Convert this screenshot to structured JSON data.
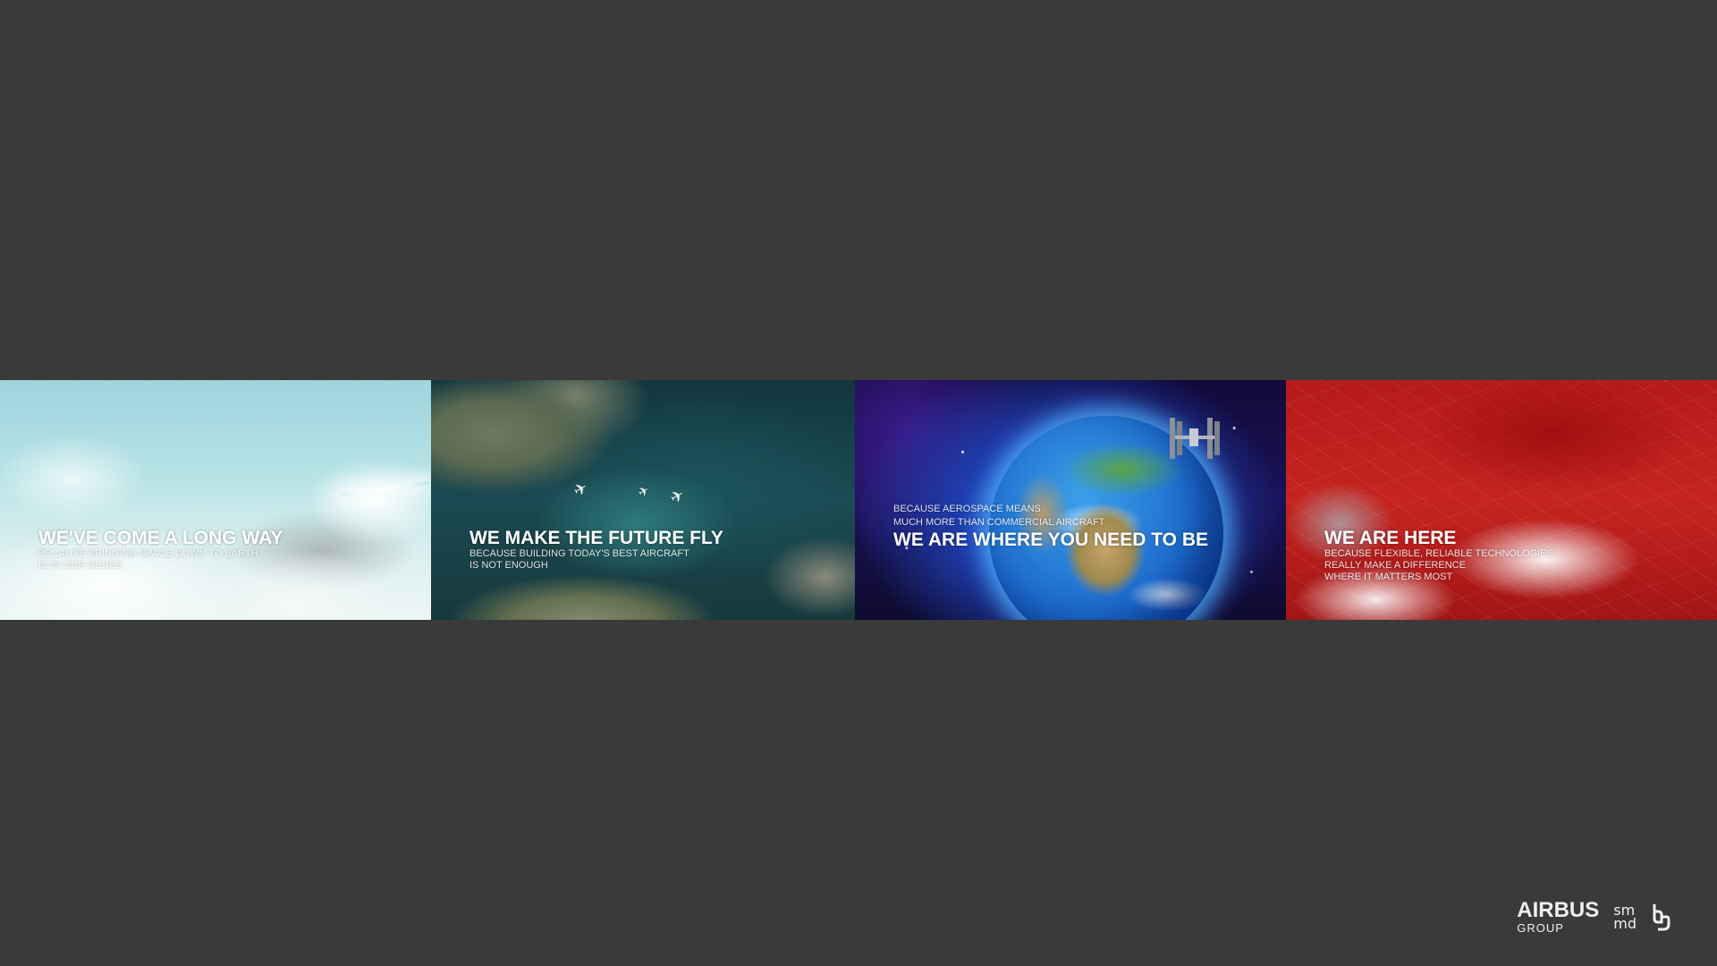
{
  "panels": [
    {
      "title": "WE'VE COME A LONG WAY",
      "subtitle_lines": [
        "BECAUSE BRINGING SPACE DOWN TO EARTH",
        "IS IN OUR GENES"
      ]
    },
    {
      "title": "WE MAKE THE FUTURE FLY",
      "subtitle_lines": [
        "BECAUSE BUILDING TODAY'S BEST AIRCRAFT",
        "IS NOT ENOUGH"
      ]
    },
    {
      "title": "WE ARE WHERE YOU NEED TO BE",
      "subtitle_lines": [
        "BECAUSE AEROSPACE MEANS",
        "MUCH MORE THAN COMMERCIAL AIRCRAFT"
      ]
    },
    {
      "title": "WE ARE HERE",
      "subtitle_lines": [
        "BECAUSE FLEXIBLE, RELIABLE TECHNOLOGIES",
        "REALLY MAKE A DIFFERENCE",
        "WHERE IT MATTERS MOST"
      ]
    }
  ],
  "logos": {
    "airbus_name": "AIRBUS",
    "airbus_group": "GROUP",
    "smmd_top": "sm",
    "smmd_bottom": "md"
  },
  "colors": {
    "background": "#3a3a3a",
    "text": "#ffffff"
  }
}
